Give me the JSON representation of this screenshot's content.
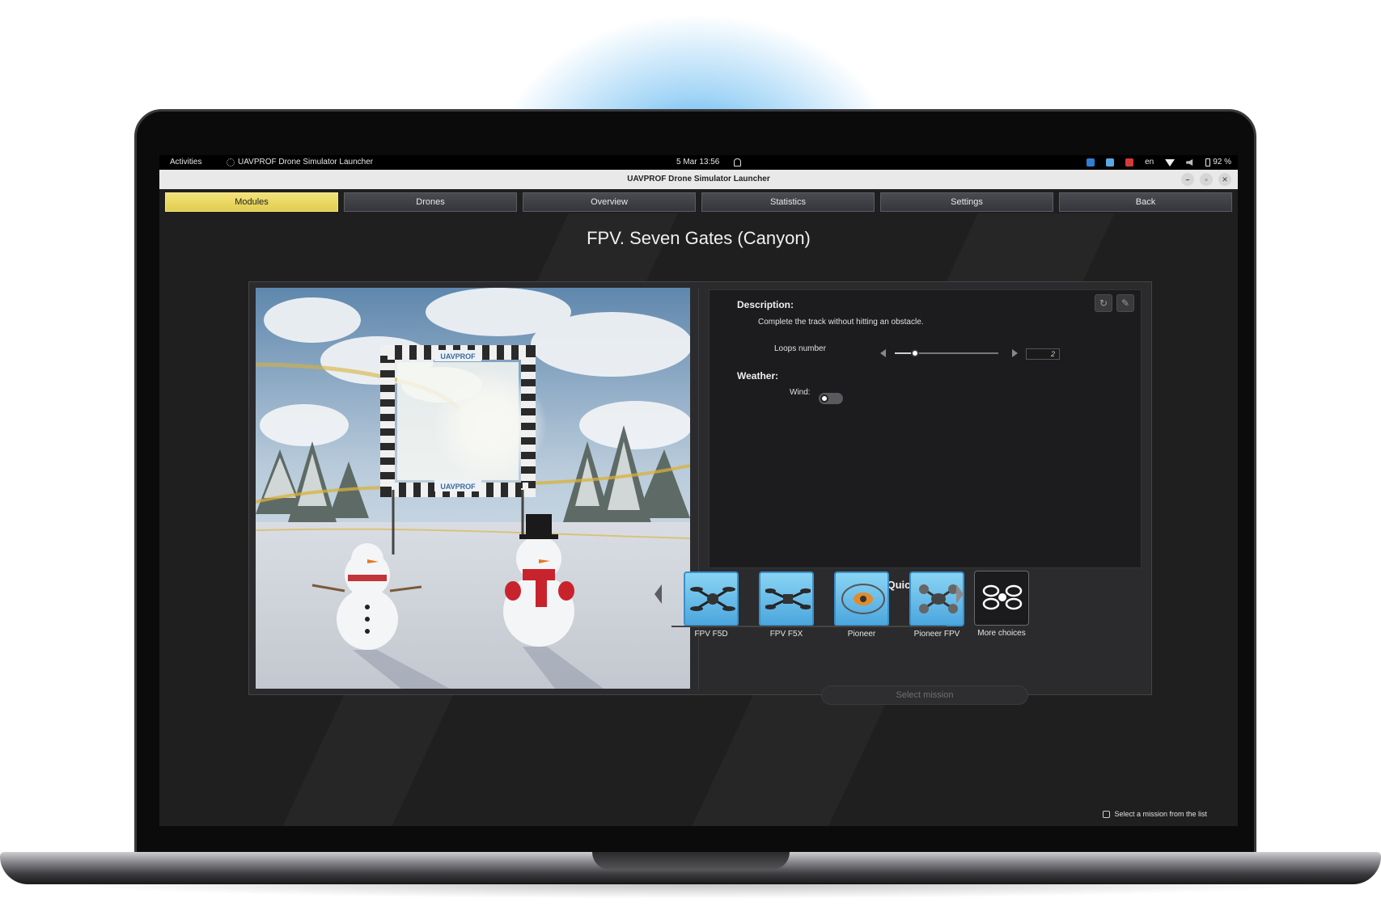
{
  "topbar": {
    "activities": "Activities",
    "app_name": "UAVPROF Drone Simulator Launcher",
    "datetime": "5 Mar  13:56",
    "language": "en",
    "battery": "92 %"
  },
  "window": {
    "title": "UAVPROF Drone Simulator Launcher"
  },
  "tabs": [
    {
      "label": "Modules",
      "active": true
    },
    {
      "label": "Drones",
      "active": false
    },
    {
      "label": "Overview",
      "active": false
    },
    {
      "label": "Statistics",
      "active": false
    },
    {
      "label": "Settings",
      "active": false
    },
    {
      "label": "Back",
      "active": false
    }
  ],
  "mission": {
    "title": "FPV. Seven Gates (Canyon)",
    "description_label": "Description:",
    "description": "Complete the track without hitting an obstacle.",
    "loops_label": "Loops number",
    "loops_value": "2",
    "weather_label": "Weather:",
    "wind_label": "Wind:",
    "wind_enabled": false
  },
  "quick_selection": {
    "title": "Quick selection",
    "items": [
      {
        "label": "FPV F5D"
      },
      {
        "label": "FPV F5X"
      },
      {
        "label": "Pioneer"
      },
      {
        "label": "Pioneer FPV"
      },
      {
        "label": "More choices"
      }
    ],
    "select_button": "Select mission"
  },
  "gate_sign": "UAVPROF",
  "footer": {
    "hint": "Select a mission from the list"
  },
  "colors": {
    "accent_tab": "#e9d865",
    "background": "#1f1f20"
  }
}
